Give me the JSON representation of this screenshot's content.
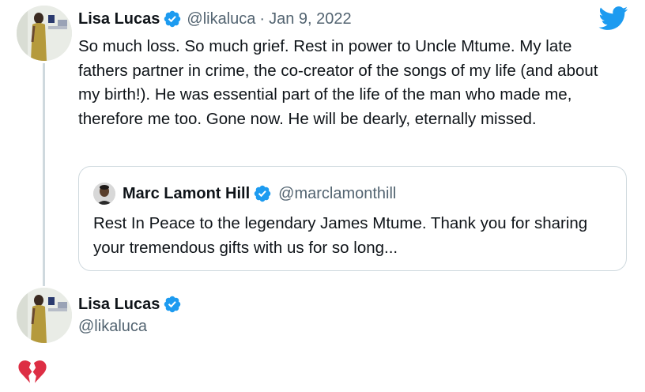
{
  "tweet": {
    "author_name": "Lisa Lucas",
    "author_handle": "@likaluca",
    "separator": "·",
    "date": "Jan 9, 2022",
    "text": "So much loss. So much grief. Rest in power to Uncle Mtume. My late fathers partner in crime, the co-creator of the songs of my life (and about my birth!). He was essential part of the life of the man who made me, therefore me too. Gone now. He will be dearly, eternally missed."
  },
  "quoted_tweet": {
    "author_name": "Marc Lamont Hill",
    "author_handle": "@marclamonthill",
    "text": "Rest In Peace to the legendary James Mtume. Thank you for sharing your tremendous gifts with us for so long..."
  },
  "reply": {
    "author_name": "Lisa Lucas",
    "author_handle": "@likaluca",
    "content_emoji": "broken-heart-icon"
  },
  "colors": {
    "twitter_blue": "#1d9bf0",
    "secondary_text": "#536471",
    "border": "#cfd9de",
    "broken_heart": "#dd2e44"
  },
  "icons": [
    "twitter-bird-icon",
    "verified-badge-icon",
    "broken-heart-icon"
  ]
}
